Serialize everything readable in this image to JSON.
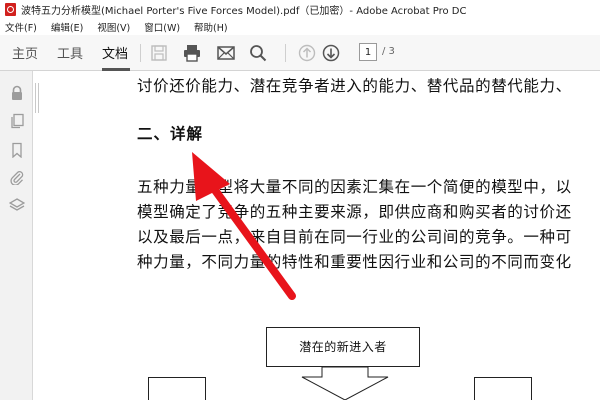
{
  "window": {
    "title": "波特五力分析模型(Michael Porter's Five Forces Model).pdf（已加密）- Adobe Acrobat Pro DC",
    "app_icon": "acrobat-icon"
  },
  "menu": [
    "文件(F)",
    "编辑(E)",
    "视图(V)",
    "窗口(W)",
    "帮助(H)"
  ],
  "toolbar": {
    "tabs": [
      {
        "label": "主页",
        "active": false
      },
      {
        "label": "工具",
        "active": false
      },
      {
        "label": "文档",
        "active": true
      }
    ],
    "icons": [
      "save-icon",
      "print-icon",
      "email-icon",
      "search-icon",
      "page-up-icon",
      "page-down-icon"
    ],
    "page_current": "1",
    "page_total": "/ 3"
  },
  "sidebar": {
    "icons": [
      "lock-icon",
      "pages-icon",
      "bookmark-icon",
      "attachment-icon",
      "layers-icon"
    ]
  },
  "document": {
    "lines": [
      "讨价还价能力、潜在竞争者进入的能力、替代品的替代能力、",
      "二、详解",
      "五种力量模型将大量不同的因素汇集在一个简便的模型中，以",
      "模型确定了竞争的五种主要来源，即供应商和购买者的讨价还",
      "以及最后一点，来自目前在同一行业的公司间的竞争。一种可",
      "种力量，不同力量的特性和重要性因行业和公司的不同而变化"
    ],
    "diagram_box_label": "潜在的新进入者"
  },
  "annotation": {
    "arrow_color": "#e8141b"
  }
}
